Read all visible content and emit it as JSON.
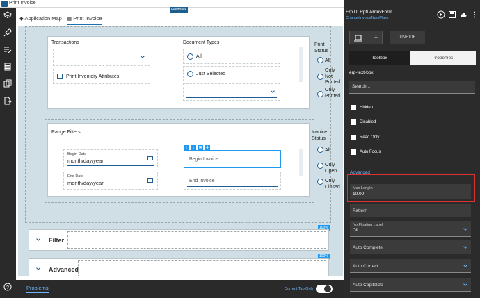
{
  "window": {
    "title": "Print Invoice",
    "feedback_label": "Feedback"
  },
  "tabs": [
    {
      "label": "Application Map",
      "icon": "diamond-icon"
    },
    {
      "label": "Print Invoice",
      "icon": "grid-icon"
    }
  ],
  "form": {
    "transactions_label": "Transactions",
    "print_inventory_label": "Print Inventory Attributes",
    "document_types_label": "Document Types",
    "doc_types_options": [
      "All",
      "Just Selected"
    ],
    "print_status_label": "Print Status",
    "print_status_options": [
      "All",
      "Only Not Printed",
      "Only Printed"
    ],
    "range_filters_label": "Range Filters",
    "begin_date_label": "Begin Date",
    "begin_date_placeholder": "month/day/year",
    "end_date_label": "End Date",
    "end_date_placeholder": "month/day/year",
    "begin_invoice_placeholder": "Begin Invoice",
    "end_invoice_placeholder": "End Invoice",
    "invoice_status_label": "Invoice Status",
    "invoice_status_options": [
      "All",
      "Only Open",
      "Only Closed"
    ],
    "filter_section": "Filter",
    "advanced_section": "Advanced",
    "pct_badge": "100%"
  },
  "statusbar": {
    "problems": "Problems",
    "current_tab_only": "Current Tab Only"
  },
  "props": {
    "header_title": "Erp.UI.RptLARInvForm",
    "header_sub": "ChangeInvoiceNumMask",
    "unhide": "UNHIDE",
    "tab_toolbox": "Toolbox",
    "tab_properties": "Properties",
    "section": "erp-text-box",
    "search_placeholder": "Search...",
    "checkboxes": [
      "Hidden",
      "Disabled",
      "Read Only",
      "Auto Focus"
    ],
    "advanced_section": "Advanced",
    "max_length_label": "Max Length",
    "max_length_value": "10.00",
    "pattern_label": "Pattern",
    "no_floating_label": "No Floating Label",
    "no_floating_value": "Off",
    "auto_complete": "Auto Complete",
    "auto_correct": "Auto Correct",
    "auto_capitalize": "Auto Capitalize"
  },
  "colors": {
    "accent": "#1b6fb5",
    "link": "#6db6ff",
    "dark": "#2b2b2b",
    "highlight": "#dd3333"
  }
}
